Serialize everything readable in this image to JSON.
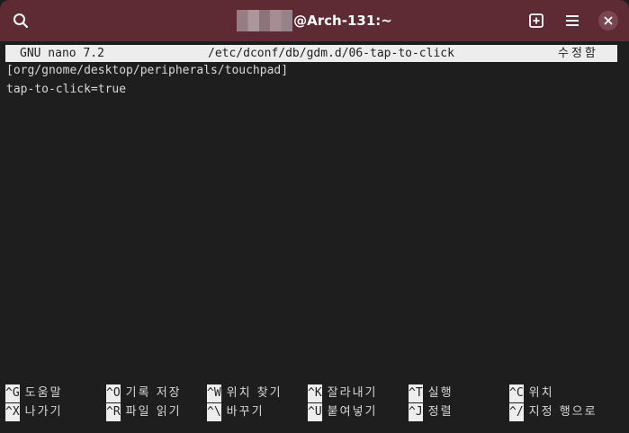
{
  "window": {
    "title_suffix": "@Arch-131:~",
    "buttons": {
      "search": "search-icon",
      "new_tab": "new-tab-icon",
      "menu": "hamburger-menu-icon",
      "close": "close-icon"
    },
    "colors": {
      "headerbar": "#5e2a33",
      "terminal_bg": "#1e1e1e",
      "text": "#d8d8d8",
      "inverse_bg": "#ededed"
    }
  },
  "nano": {
    "version": "GNU nano 7.2",
    "file_path": "/etc/dconf/db/gdm.d/06-tap-to-click",
    "status": "수정함",
    "lines": [
      "[org/gnome/desktop/peripherals/touchpad]",
      "tap-to-click=true"
    ],
    "shortcuts": [
      [
        {
          "key": "^G",
          "label": "도움말"
        },
        {
          "key": "^O",
          "label": "기록 저장"
        },
        {
          "key": "^W",
          "label": "위치 찾기"
        },
        {
          "key": "^K",
          "label": "잘라내기"
        },
        {
          "key": "^T",
          "label": "실행"
        },
        {
          "key": "^C",
          "label": "위치"
        }
      ],
      [
        {
          "key": "^X",
          "label": "나가기"
        },
        {
          "key": "^R",
          "label": "파일 읽기"
        },
        {
          "key": "^\\",
          "label": "바꾸기"
        },
        {
          "key": "^U",
          "label": "붙여넣기"
        },
        {
          "key": "^J",
          "label": "정렬"
        },
        {
          "key": "^/",
          "label": "지정 행으로"
        }
      ]
    ]
  }
}
